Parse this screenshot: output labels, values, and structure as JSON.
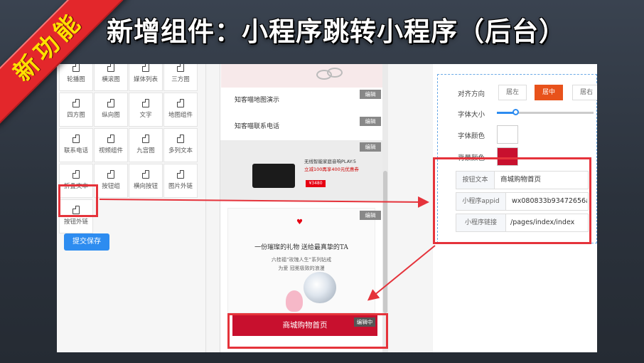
{
  "banner": {
    "title": "新增组件：小程序跳转小程序（后台）",
    "ribbon": "新功能"
  },
  "left": {
    "components": [
      {
        "label": "轮播图"
      },
      {
        "label": "横滚图"
      },
      {
        "label": "媒体列表"
      },
      {
        "label": "三方图"
      },
      {
        "label": "四方图"
      },
      {
        "label": "纵向图"
      },
      {
        "label": "文字"
      },
      {
        "label": "地图组件"
      },
      {
        "label": "联系电话"
      },
      {
        "label": "视频组件"
      },
      {
        "label": "九宫图"
      },
      {
        "label": "多列文本"
      },
      {
        "label": "折叠文本"
      },
      {
        "label": "按钮组"
      },
      {
        "label": "横向按钮"
      },
      {
        "label": "图片外链"
      },
      {
        "label": "按钮外链"
      }
    ],
    "submit_label": "提交保存"
  },
  "preview": {
    "map_demo": "知客喵地图演示",
    "phone_contact": "知客喵联系电话",
    "edit_label": "编辑",
    "product_line1": "无线智能家庭音响PLAY:5",
    "product_line2": "立减100再享400元优惠券",
    "product_price": "¥3480",
    "jewel_title": "一份璀璨的礼物 送给最真挚的TA",
    "jewel_line1": "六桂福“玫瑰人生”系列钻戒",
    "jewel_line2": "为爱 冠冕极致的浪漫",
    "mall_button": "商城购物首页",
    "editing_label": "编辑中"
  },
  "settings": {
    "align_label": "对齐方向",
    "align_options": [
      "居左",
      "居中",
      "居右"
    ],
    "align_selected": "居中",
    "font_size_label": "字体大小",
    "font_size_level": 0.2,
    "font_color_label": "字体颜色",
    "font_color": "#ffffff",
    "bg_color_label": "背景颜色",
    "bg_color": "#c8102e",
    "button_text_label": "按钮文本",
    "button_text_value": "商城购物首页",
    "appid_label": "小程序appid",
    "appid_value": "wx080833b93472656a",
    "link_label": "小程序链接",
    "link_value": "/pages/index/index"
  },
  "colors": {
    "accent_orange": "#e8521b",
    "highlight_red": "#e5333b",
    "primary_blue": "#2d8cf0"
  }
}
